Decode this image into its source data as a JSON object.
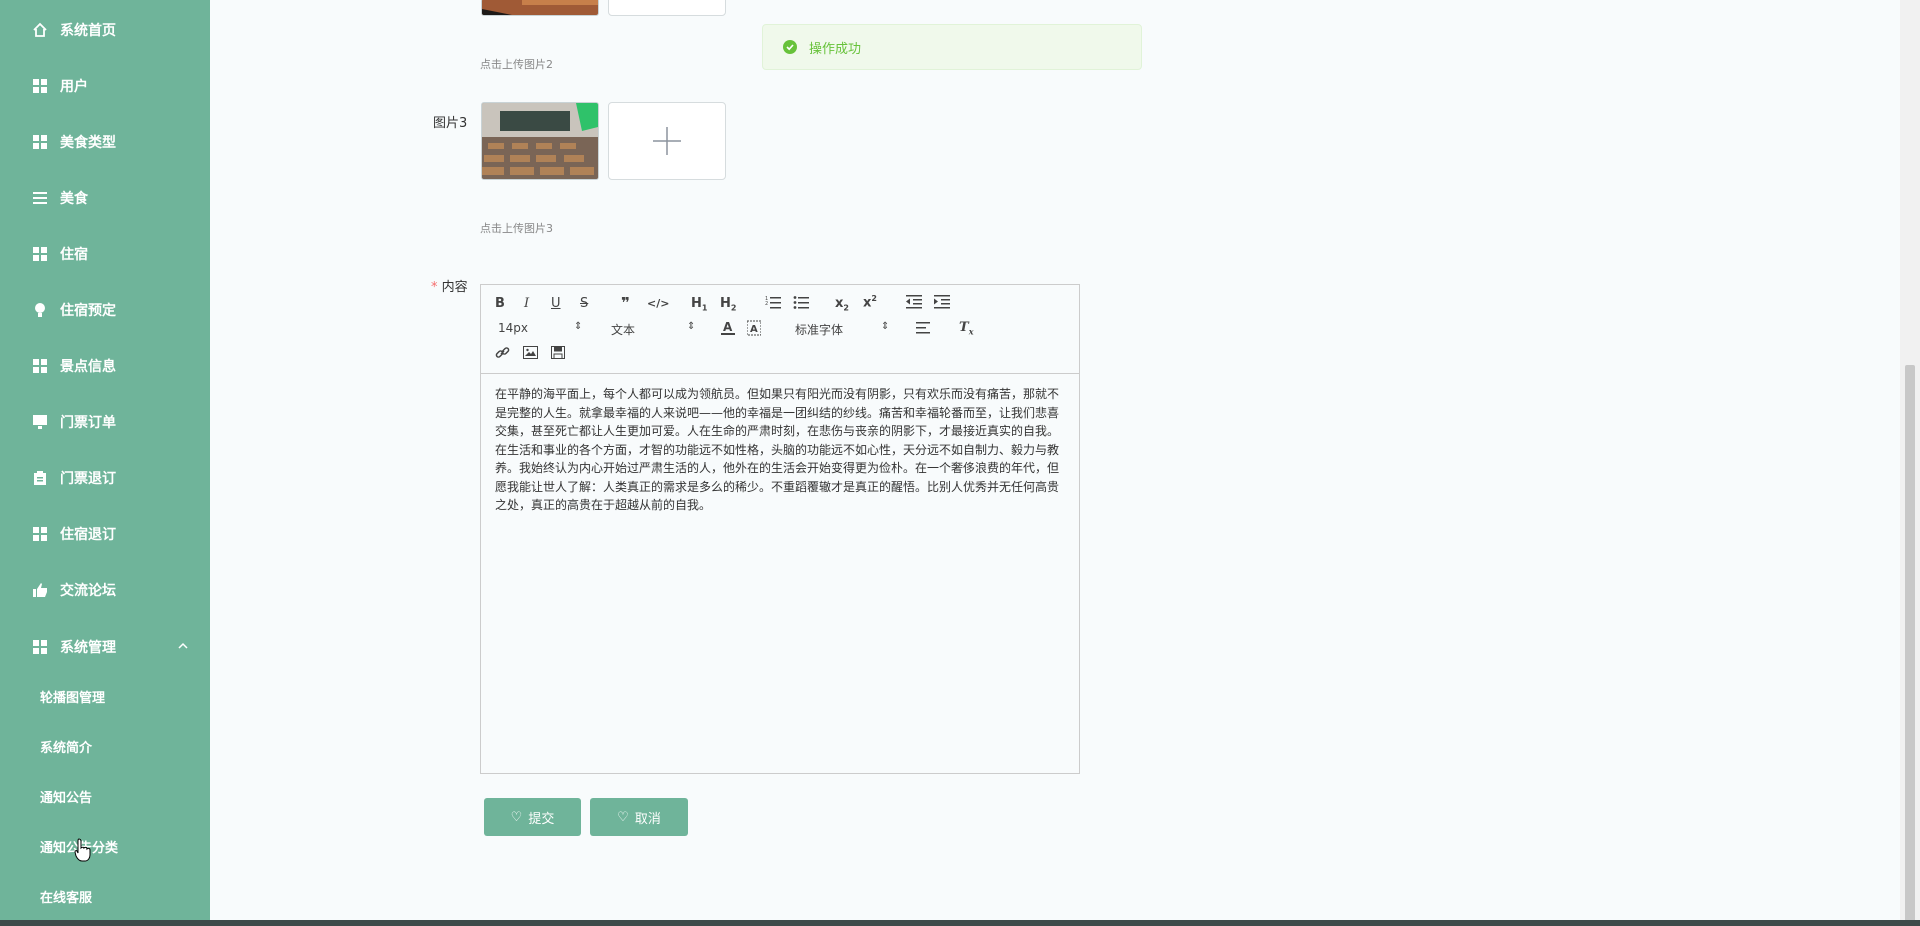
{
  "sidebar": {
    "items": [
      {
        "label": "系统首页",
        "icon": "home-icon"
      },
      {
        "label": "用户",
        "icon": "grid-icon"
      },
      {
        "label": "美食类型",
        "icon": "grid-icon"
      },
      {
        "label": "美食",
        "icon": "list-icon"
      },
      {
        "label": "住宿",
        "icon": "grid-icon"
      },
      {
        "label": "住宿预定",
        "icon": "bulb-icon"
      },
      {
        "label": "景点信息",
        "icon": "grid-icon"
      },
      {
        "label": "门票订单",
        "icon": "monitor-icon"
      },
      {
        "label": "门票退订",
        "icon": "clipboard-icon"
      },
      {
        "label": "住宿退订",
        "icon": "grid-icon"
      },
      {
        "label": "交流论坛",
        "icon": "thumb-icon"
      },
      {
        "label": "系统管理",
        "icon": "grid-icon"
      }
    ],
    "sub_items": [
      {
        "label": "轮播图管理"
      },
      {
        "label": "系统简介"
      },
      {
        "label": "通知公告"
      },
      {
        "label": "通知公告分类"
      },
      {
        "label": "在线客服"
      }
    ]
  },
  "toast": {
    "message": "操作成功",
    "color": "#67c23a"
  },
  "form": {
    "hint_image2": "点击上传图片2",
    "image3_label": "图片3",
    "hint_image3": "点击上传图片3",
    "content_label": "内容",
    "required_mark": "*"
  },
  "editor": {
    "font_size": "14px",
    "header_select": "文本",
    "font_select": "标准字体",
    "content": "在平静的海平面上，每个人都可以成为领航员。但如果只有阳光而没有阴影，只有欢乐而没有痛苦，那就不是完整的人生。就拿最幸福的人来说吧——他的幸福是一团纠结的纱线。痛苦和幸福轮番而至，让我们悲喜交集，甚至死亡都让人生更加可爱。人在生命的严肃时刻，在悲伤与丧亲的阴影下，才最接近真实的自我。在生活和事业的各个方面，才智的功能远不如性格，头脑的功能远不如心性，天分远不如自制力、毅力与教养。我始终认为内心开始过严肃生活的人，他外在的生活会开始变得更为俭朴。在一个奢侈浪费的年代，但愿我能让世人了解：人类真正的需求是多么的稀少。不重蹈覆辙才是真正的醒悟。比别人优秀并无任何高贵之处，真正的高贵在于超越从前的自我。"
  },
  "buttons": {
    "submit": "提交",
    "cancel": "取消"
  },
  "colors": {
    "sidebar": "#6fb49a",
    "button": "#6fb49a",
    "required": "#f56c6c"
  }
}
